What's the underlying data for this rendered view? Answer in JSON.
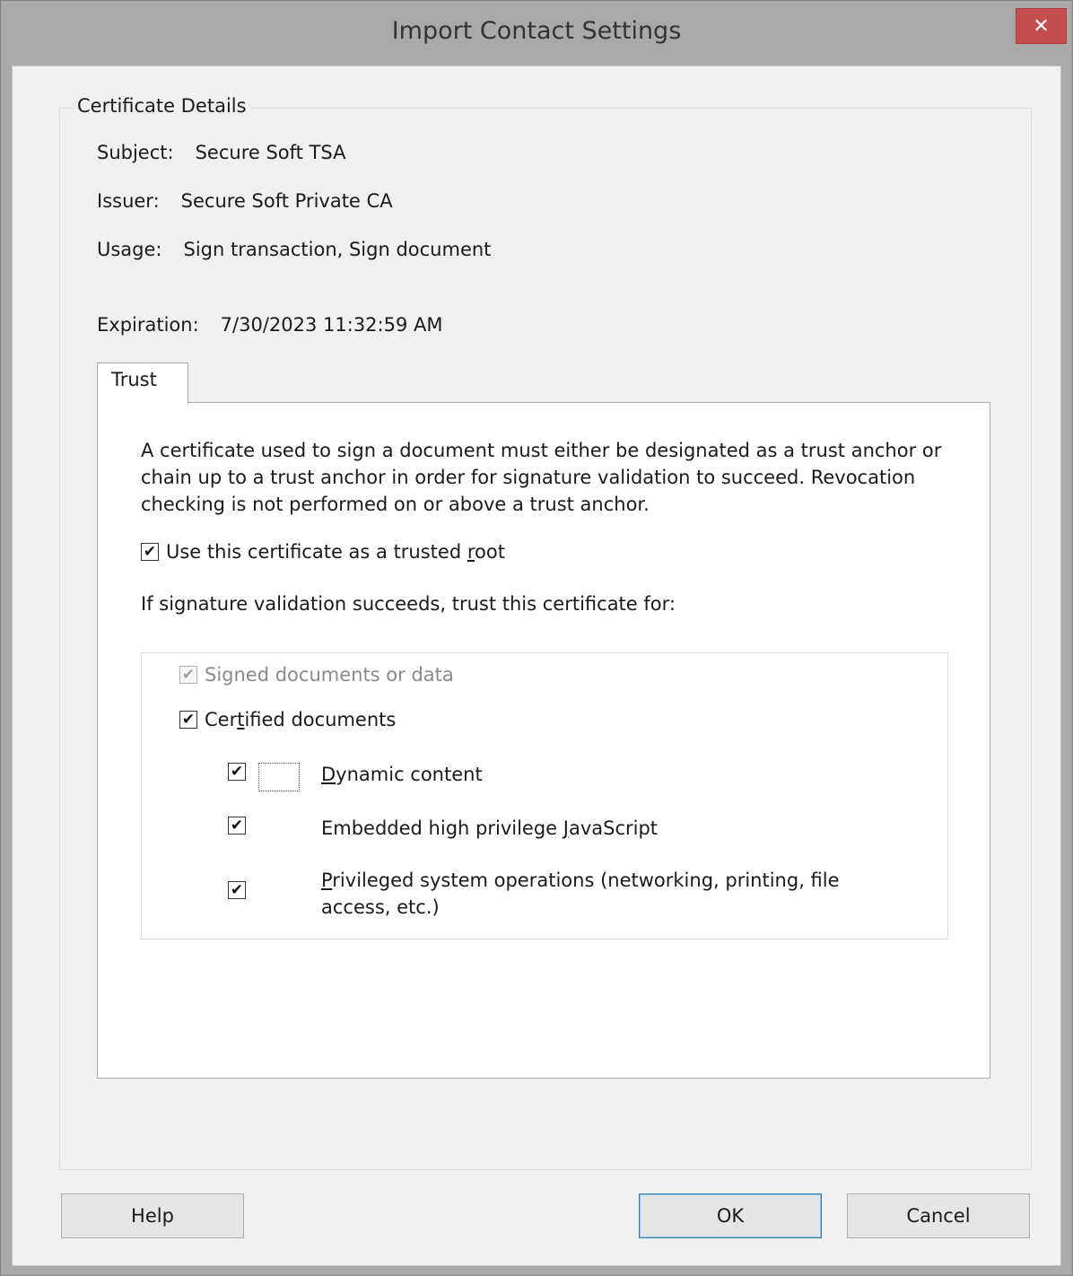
{
  "window": {
    "title": "Import Contact Settings",
    "close_glyph": "✕"
  },
  "certificate_details": {
    "legend": "Certificate Details",
    "subject_label": "Subject:",
    "subject_value": "Secure Soft TSA",
    "issuer_label": "Issuer:",
    "issuer_value": "Secure Soft Private CA",
    "usage_label": "Usage:",
    "usage_value": "Sign transaction, Sign document",
    "expiration_label": "Expiration:",
    "expiration_value": "7/30/2023 11:32:59 AM"
  },
  "tabs": [
    {
      "label": "Trust",
      "selected": true
    }
  ],
  "trust": {
    "description": "A certificate used to sign a document must either be designated as a trust anchor or chain up to a trust anchor in order for signature validation to succeed.  Revocation checking is not performed on or above a trust anchor.",
    "trusted_root": {
      "label_pre": "Use this certificate as a trusted ",
      "label_key": "r",
      "label_post": "oot",
      "checked": true
    },
    "intro": "If signature validation succeeds, trust this certificate for:",
    "signed_documents": {
      "label": "Signed documents or data",
      "checked": true,
      "disabled": true
    },
    "certified_documents": {
      "label_pre": "Cer",
      "label_key": "t",
      "label_post": "ified documents",
      "checked": true
    },
    "dynamic_content": {
      "label_key": "D",
      "label_post": "ynamic content",
      "checked": true
    },
    "javascript": {
      "label_pre": "Embedded high privilege ",
      "label_key": "J",
      "label_post": "avaScript",
      "checked": true
    },
    "system_operations": {
      "label_key": "P",
      "label_post": "rivileged system operations (networking, printing, file access, etc.)",
      "checked": true
    }
  },
  "buttons": {
    "help": "Help",
    "ok": "OK",
    "cancel": "Cancel"
  },
  "check_glyph": "✔"
}
